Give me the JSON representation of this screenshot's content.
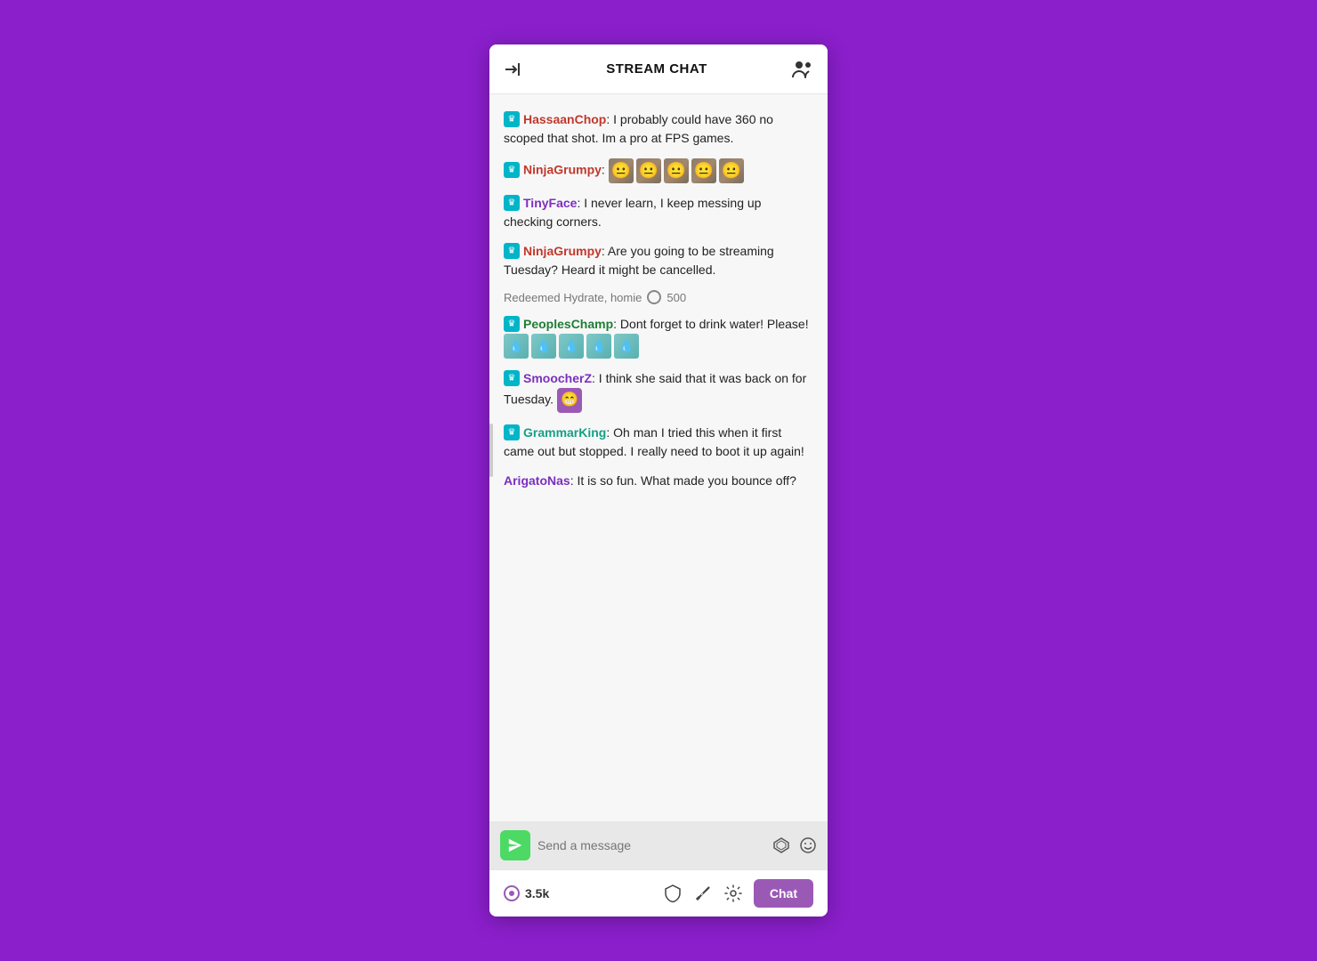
{
  "header": {
    "title": "STREAM CHAT",
    "collapse_icon": "collapse-icon",
    "users_icon": "users-icon"
  },
  "messages": [
    {
      "id": 1,
      "has_badge": true,
      "username": "HassaanChop",
      "username_color": "red",
      "text": ": I probably could have 360 no scoped that shot. Im a pro at FPS games.",
      "emotes": []
    },
    {
      "id": 2,
      "has_badge": true,
      "username": "NinjaGrumpy",
      "username_color": "red",
      "text": ":",
      "emotes": [
        "face",
        "face",
        "face",
        "face",
        "face"
      ]
    },
    {
      "id": 3,
      "has_badge": true,
      "username": "TinyFace",
      "username_color": "purple",
      "text": ": I never learn, I keep messing up checking corners.",
      "emotes": []
    },
    {
      "id": 4,
      "has_badge": true,
      "username": "NinjaGrumpy",
      "username_color": "red",
      "text": ": Are you going to be streaming Tuesday? Heard it might be cancelled.",
      "emotes": []
    }
  ],
  "redemption": {
    "text": "Redeemed Hydrate, homie",
    "points": "500"
  },
  "messages2": [
    {
      "id": 5,
      "has_badge": true,
      "username": "PeoplesChamp",
      "username_color": "green",
      "text": ": Dont forget to drink water! Please!",
      "emotes": [
        "water",
        "water",
        "water",
        "water",
        "water"
      ]
    },
    {
      "id": 6,
      "has_badge": true,
      "username": "SmoocherZ",
      "username_color": "purple",
      "text": ": I think she said that it was back on for Tuesday.",
      "emotes": [
        "smile-purple"
      ]
    },
    {
      "id": 7,
      "has_badge": true,
      "username": "GrammarKing",
      "username_color": "teal",
      "text": ": Oh man I tried this when it first came out but stopped. I really need to boot it up again!",
      "emotes": []
    },
    {
      "id": 8,
      "has_badge": false,
      "username": "ArigatoNas",
      "username_color": "purple",
      "text": ": It is so fun. What made you bounce off?",
      "emotes": []
    }
  ],
  "input": {
    "placeholder": "Send a message"
  },
  "bottom_bar": {
    "viewer_count": "3.5k",
    "chat_button": "Chat"
  }
}
